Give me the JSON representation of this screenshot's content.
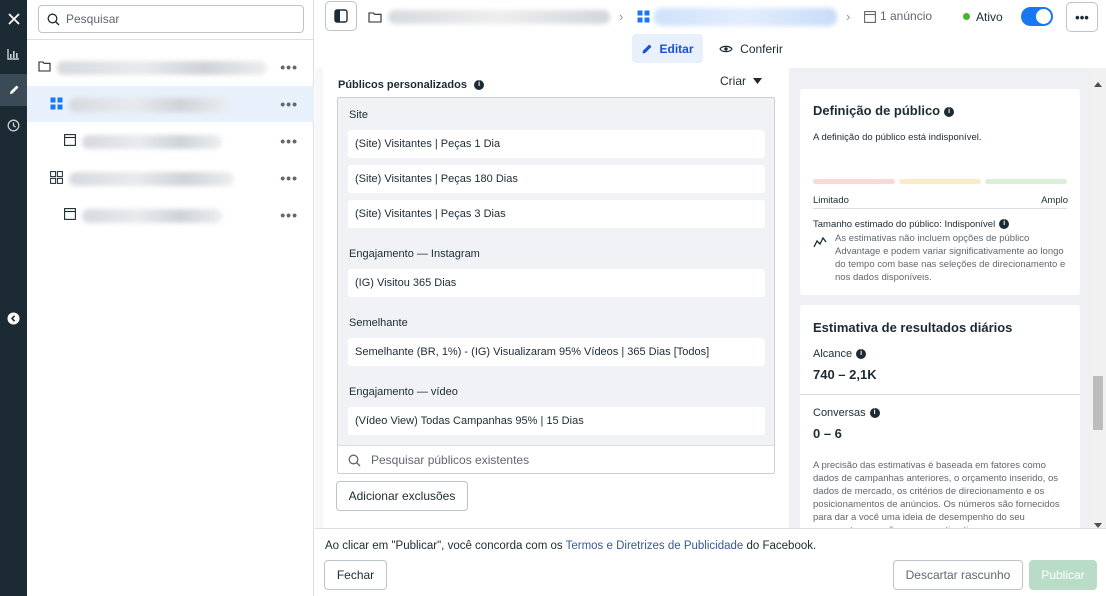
{
  "search": {
    "placeholder": "Pesquisar"
  },
  "tree": {
    "more_label": "•••"
  },
  "topbar": {
    "ads_count": "1 anúncio",
    "status": "Ativo",
    "more_label": "•••"
  },
  "tabs": {
    "edit": "Editar",
    "review": "Conferir"
  },
  "audiences": {
    "title": "Públicos personalizados",
    "create_label": "Criar",
    "groups": [
      {
        "label": "Site",
        "items": [
          "(Site) Visitantes | Peças 1 Dia",
          "(Site) Visitantes | Peças 180 Dias",
          "(Site) Visitantes | Peças 3 Dias"
        ]
      },
      {
        "label": "Engajamento — Instagram",
        "items": [
          "(IG) Visitou 365 Dias"
        ]
      },
      {
        "label": "Semelhante",
        "items": [
          "Semelhante (BR, 1%) - (IG) Visualizaram 95% Vídeos | 365 Dias [Todos]"
        ]
      },
      {
        "label": "Engajamento — vídeo",
        "items": [
          "(Vídeo View) Todas Campanhas 95% | 15 Dias"
        ]
      }
    ],
    "search_placeholder": "Pesquisar públicos existentes",
    "add_exclusions": "Adicionar exclusões"
  },
  "definition": {
    "title": "Definição de público",
    "unavailable": "A definição do público está indisponível.",
    "limited": "Limitado",
    "broad": "Amplo",
    "size_label": "Tamanho estimado do público: Indisponível",
    "size_note": "As estimativas não incluem opções de público Advantage e podem variar significativamente ao longo do tempo com base nas seleções de direcionamento e nos dados disponíveis."
  },
  "estimates": {
    "title": "Estimativa de resultados diários",
    "reach_label": "Alcance",
    "reach_value": "740 – 2,1K",
    "conv_label": "Conversas",
    "conv_value": "0 – 6",
    "note": "A precisão das estimativas é baseada em fatores como dados de campanhas anteriores, o orçamento inserido, os dados de mercado, os critérios de direcionamento e os posicionamentos de anúncios. Os números são fornecidos para dar a você uma ideia de desempenho do seu orçamento, mas são apenas estimativas."
  },
  "footer": {
    "terms_pre": "Ao clicar em \"Publicar\", você concorda com os ",
    "terms_link": "Termos e Diretrizes de Publicidade",
    "terms_post": " do Facebook.",
    "close": "Fechar",
    "discard": "Descartar rascunho",
    "publish": "Publicar"
  },
  "colors": {
    "accent": "#1877f2",
    "status_active": "#42b72a",
    "publish_disabled": "#b9dcc8"
  }
}
